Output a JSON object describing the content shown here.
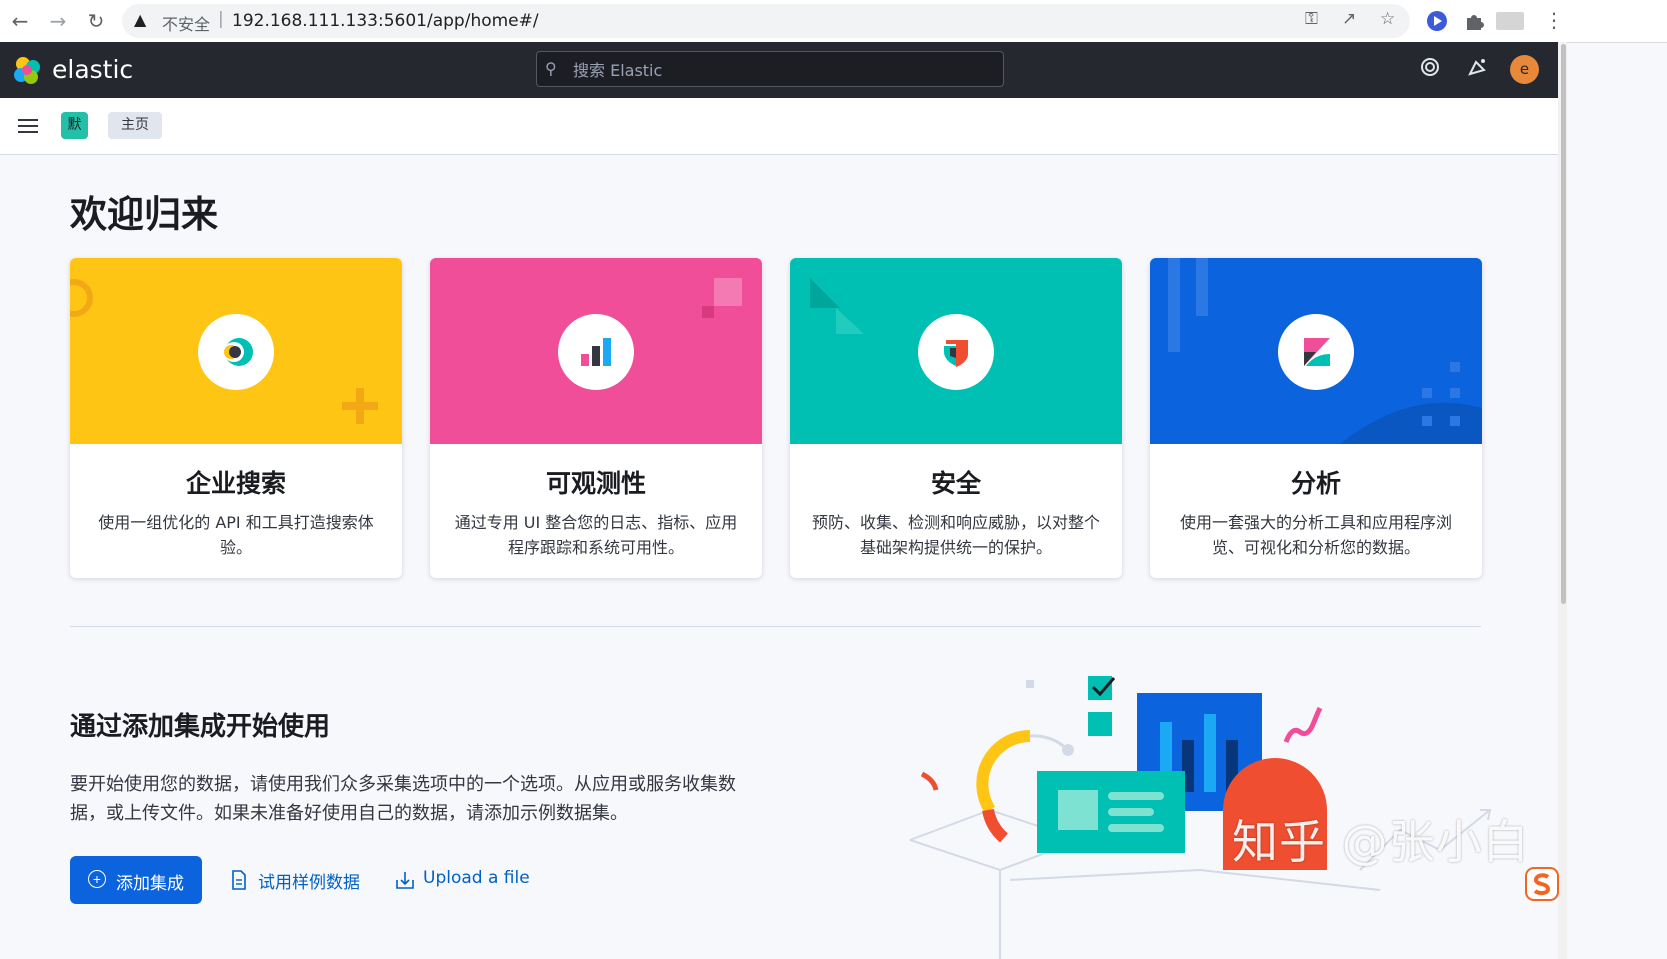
{
  "browser": {
    "back_icon": "arrow-left-icon",
    "forward_icon": "arrow-right-icon",
    "reload_icon": "reload-icon",
    "security_label": "不安全",
    "separator": "|",
    "url": "192.168.111.133:5601/app/home#/"
  },
  "header": {
    "logo_text": "elastic",
    "search_placeholder": "搜索 Elastic",
    "avatar_letter": "e"
  },
  "subheader": {
    "space_initial": "默",
    "breadcrumb": "主页"
  },
  "welcome_title": "欢迎归来",
  "solutions": [
    {
      "title": "企业搜索",
      "description": "使用一组优化的 API 和工具打造搜索体验。",
      "color": "#fec514"
    },
    {
      "title": "可观测性",
      "description": "通过专用 UI 整合您的日志、指标、应用程序跟踪和系统可用性。",
      "color": "#f04e98"
    },
    {
      "title": "安全",
      "description": "预防、收集、检测和响应威胁，以对整个基础架构提供统一的保护。",
      "color": "#00bfb3"
    },
    {
      "title": "分析",
      "description": "使用一套强大的分析工具和应用程序浏览、可视化和分析您的数据。",
      "color": "#0b64dd"
    }
  ],
  "integrations": {
    "title": "通过添加集成开始使用",
    "description": "要开始使用您的数据，请使用我们众多采集选项中的一个选项。从应用或服务收集数据，或上传文件。如果未准备好使用自己的数据，请添加示例数据集。",
    "add_button": "添加集成",
    "sample_data": "试用样例数据",
    "upload": "Upload a file"
  },
  "watermark": "知乎 @张小白",
  "colors": {
    "header_bg": "#25282f",
    "page_bg": "#f7f8fc",
    "primary": "#0b64dd",
    "link": "#0061c2"
  }
}
